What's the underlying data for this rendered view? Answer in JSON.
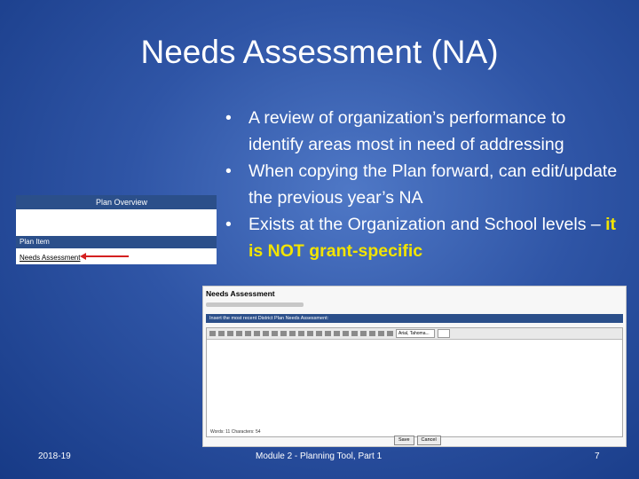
{
  "slide": {
    "title": "Needs Assessment (NA)",
    "bullets": [
      {
        "text": "A review of organization’s performance to identify areas most in need of addressing"
      },
      {
        "text": "When copying the Plan forward, can edit/update the previous year’s NA"
      },
      {
        "text_before": "Exists at the Organization and School levels – ",
        "highlight": "it is NOT grant-specific"
      }
    ],
    "bullet_char": "•",
    "highlight_color": "#f2e400"
  },
  "plan_overview": {
    "header": "Plan Overview",
    "item_header": "Plan Item",
    "link": "Needs Assessment"
  },
  "na_form": {
    "title": "Needs Assessment",
    "bar_label": "Insert the most recent District Plan Needs Assessment:",
    "font_select": "Arial, Tahoma...",
    "status": "Words: 11   Characters: 54",
    "save": "Save",
    "cancel": "Cancel"
  },
  "footer": {
    "year": "2018-19",
    "module": "Module 2 - Planning Tool, Part 1",
    "page": "7"
  }
}
